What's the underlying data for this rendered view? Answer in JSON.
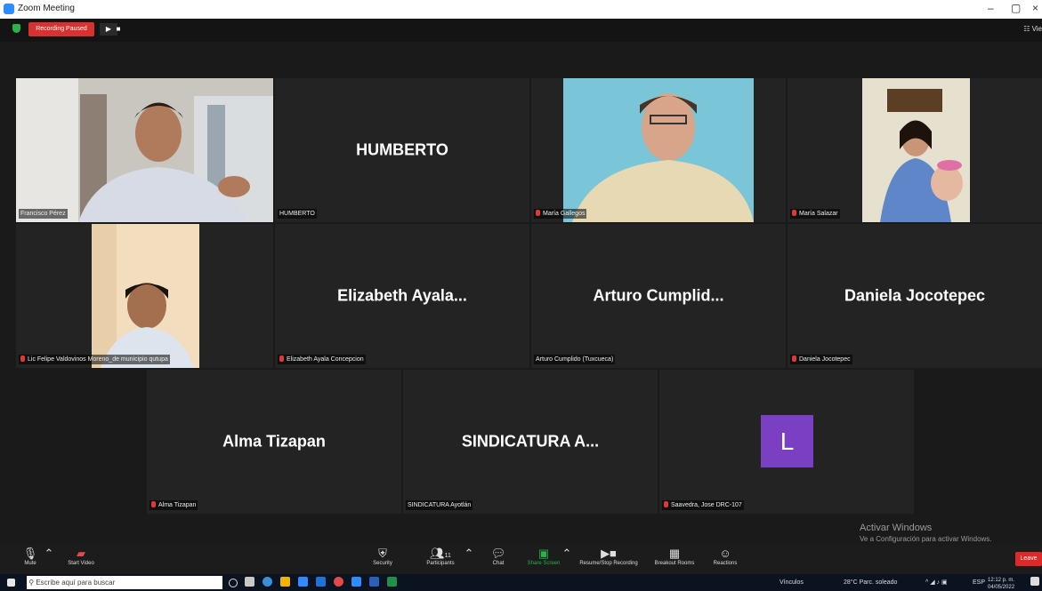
{
  "window": {
    "title": "Zoom Meeting",
    "minimize": "–",
    "maximize": "▢",
    "close": "×"
  },
  "top_bar": {
    "recording_status": "Recording Paused",
    "view_label": "☷ Vie"
  },
  "participants": [
    {
      "name": "Francisco Pérez",
      "display": "",
      "muted": false,
      "video": true,
      "active": true
    },
    {
      "name": "HUMBERTO",
      "display": "HUMBERTO",
      "muted": false,
      "video": false
    },
    {
      "name": "María Gallegos",
      "display": "",
      "muted": true,
      "video": true
    },
    {
      "name": "María Salazar",
      "display": "",
      "muted": true,
      "video": true
    },
    {
      "name": "Lic Felipe Valdovinos Moreno_de municipio qutupa",
      "display": "",
      "muted": true,
      "video": true
    },
    {
      "name": "Elizabeth Ayala Concepcion",
      "display": "Elizabeth  Ayala...",
      "muted": true,
      "video": false
    },
    {
      "name": "Arturo Cumplido (Tuxcueca)",
      "display": "Arturo  Cumplid...",
      "muted": false,
      "video": false
    },
    {
      "name": "Daniela Jocotepec",
      "display": "Daniela Jocotepec",
      "muted": true,
      "video": false
    },
    {
      "name": "Alma Tizapan",
      "display": "Alma Tizapan",
      "muted": true,
      "video": false
    },
    {
      "name": "SINDICATURA Ayotlán",
      "display": "SINDICATURA  A...",
      "muted": false,
      "video": false
    },
    {
      "name": "Saavedra, Jose DRC-107",
      "display": "L",
      "muted": true,
      "video": false,
      "avatar_color": "#7a3fc2"
    }
  ],
  "watermark": {
    "line1": "Activar Windows",
    "line2": "Ve a Configuración para activar Windows."
  },
  "toolbar": {
    "mute": "Mute",
    "start_video": "Start Video",
    "security": "Security",
    "participants": "Participants",
    "participant_count": "11",
    "chat": "Chat",
    "share_screen": "Share Screen",
    "resume_stop_recording": "Resume/Stop Recording",
    "breakout_rooms": "Breakout Rooms",
    "reactions": "Reactions",
    "leave": "Leave"
  },
  "taskbar": {
    "search_placeholder": "Escribe aquí para buscar",
    "links": "Vínculos",
    "weather": "28°C  Parc. soleado",
    "language": "ESP",
    "time": "12:12 p. m.",
    "date": "04/05/2022"
  },
  "colors": {
    "accent_active": "#c8d634",
    "recording": "#d93030",
    "leave": "#e02828",
    "share": "#2bb24c"
  }
}
